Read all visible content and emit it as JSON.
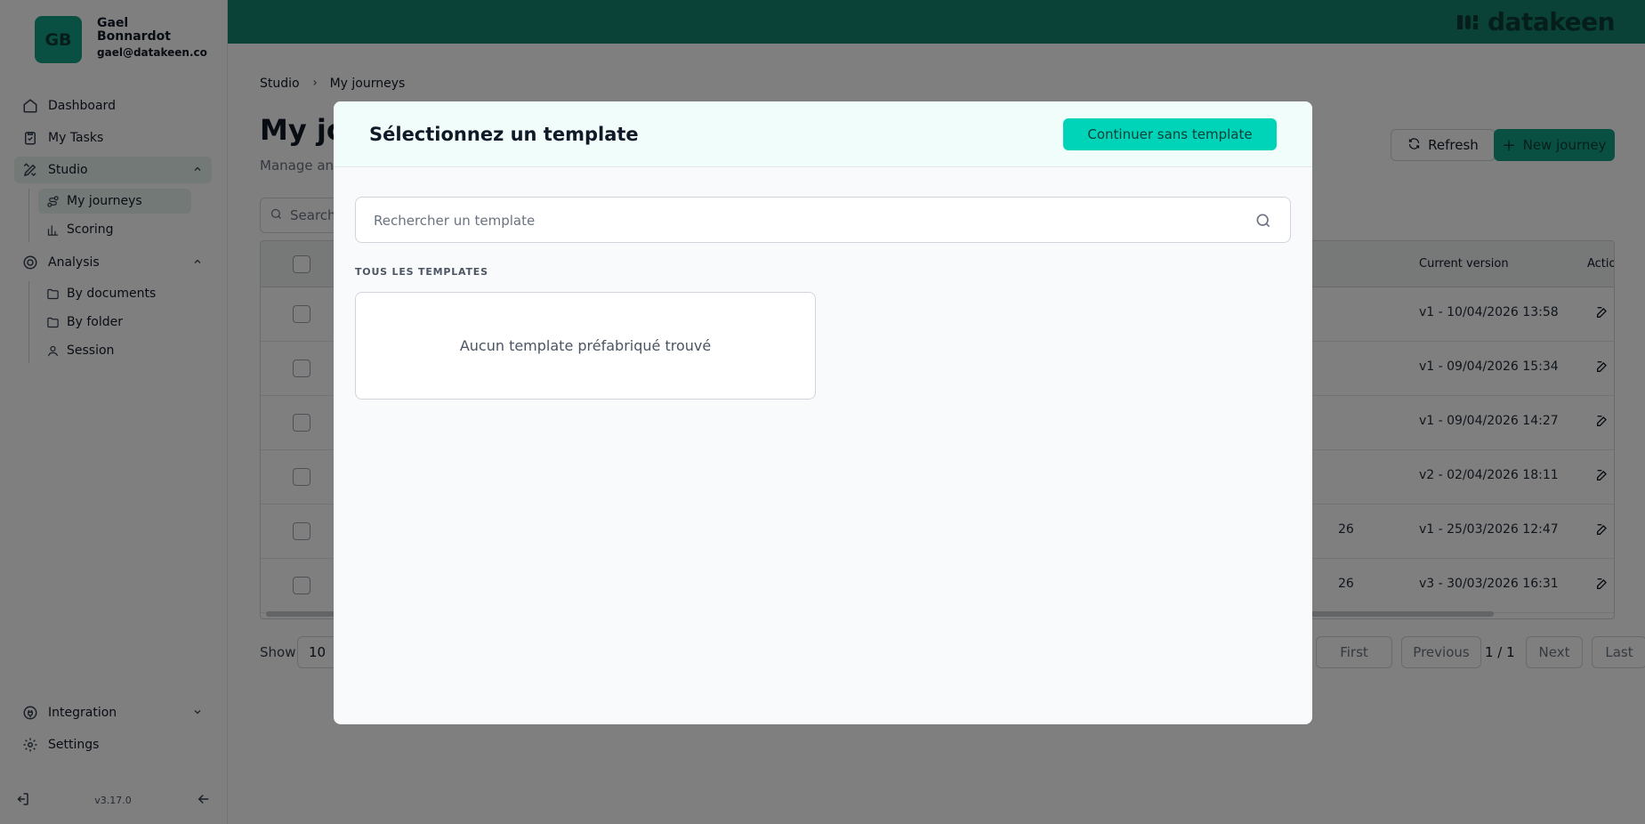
{
  "user": {
    "initials": "GB",
    "name": "Gael Bonnardot",
    "email": "gael@datakeen.co"
  },
  "sidebar": {
    "dashboard": "Dashboard",
    "tasks": "My Tasks",
    "studio": "Studio",
    "studio_items": [
      "My journeys",
      "Scoring"
    ],
    "analysis": "Analysis",
    "analysis_items": [
      "By documents",
      "By folder",
      "Session"
    ],
    "integration": "Integration",
    "settings": "Settings",
    "version": "v3.17.0"
  },
  "brand": {
    "name": "datakeen",
    "color": "#14846f"
  },
  "main": {
    "breadcrumb": [
      "Studio",
      "My journeys"
    ],
    "title": "My jo",
    "subtitle": "Manage and",
    "refresh_label": "Refresh",
    "new_label": "New journey",
    "search_placeholder": "Search",
    "table": {
      "headers": {
        "current_version": "Current version",
        "actions": "Actio"
      },
      "rows": [
        {
          "date": "",
          "version": "v1 - 10/04/2026 13:58"
        },
        {
          "date": "",
          "version": "v1 - 09/04/2026 15:34"
        },
        {
          "date": "",
          "version": "v1 - 09/04/2026 14:27"
        },
        {
          "date": "",
          "version": "v2 - 02/04/2026 18:11"
        },
        {
          "date": "26",
          "version": "v1 - 25/03/2026 12:47"
        },
        {
          "date": "26",
          "version": "v3 - 30/03/2026 16:31"
        }
      ]
    },
    "pagination": {
      "show_label": "Show",
      "page_size": "10",
      "first": "First",
      "previous": "Previous",
      "page_info": "1 / 1",
      "next": "Next",
      "last": "Last"
    }
  },
  "modal": {
    "title": "Sélectionnez un template",
    "continue_label": "Continuer sans template",
    "search_placeholder": "Rechercher un template",
    "section_label": "TOUS LES TEMPLATES",
    "empty_text": "Aucun template préfabriqué trouvé"
  }
}
